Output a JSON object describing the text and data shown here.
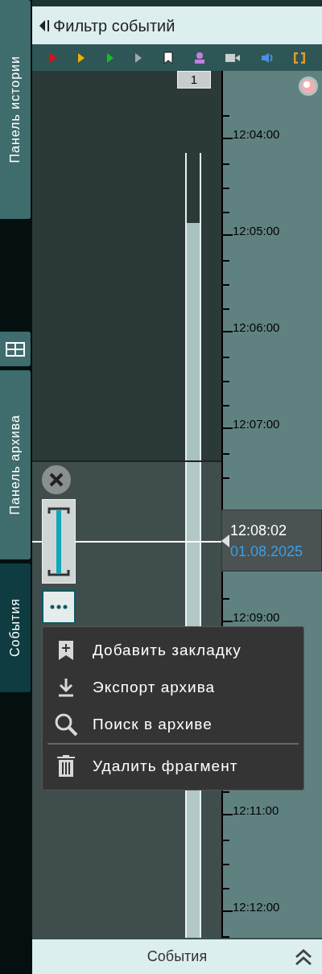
{
  "sidebar": {
    "tabs": [
      {
        "label": "Панель истории",
        "selected": false
      },
      {
        "label": "Панель архива",
        "selected": false
      },
      {
        "label": "События",
        "selected": true
      }
    ]
  },
  "header": {
    "title": "Фильтр событий"
  },
  "timeline": {
    "counter": "1",
    "upper_ticks": [
      "12:04:00",
      "12:05:00",
      "12:06:00",
      "12:07:00"
    ],
    "lower_ticks": [
      "12:09:00"
    ],
    "bottom_ticks": [
      "12:11:00",
      "12:12:00"
    ],
    "cursor": {
      "time": "12:08:02",
      "date": "01.08.2025"
    }
  },
  "menu": {
    "groups": [
      [
        {
          "kind": "bookmark",
          "label": "Добавить закладку"
        },
        {
          "kind": "export",
          "label": "Экспорт архива"
        },
        {
          "kind": "search",
          "label": "Поиск в архиве"
        }
      ],
      [
        {
          "kind": "delete",
          "label": "Удалить фрагмент"
        }
      ]
    ]
  },
  "footer": {
    "title": "События"
  }
}
